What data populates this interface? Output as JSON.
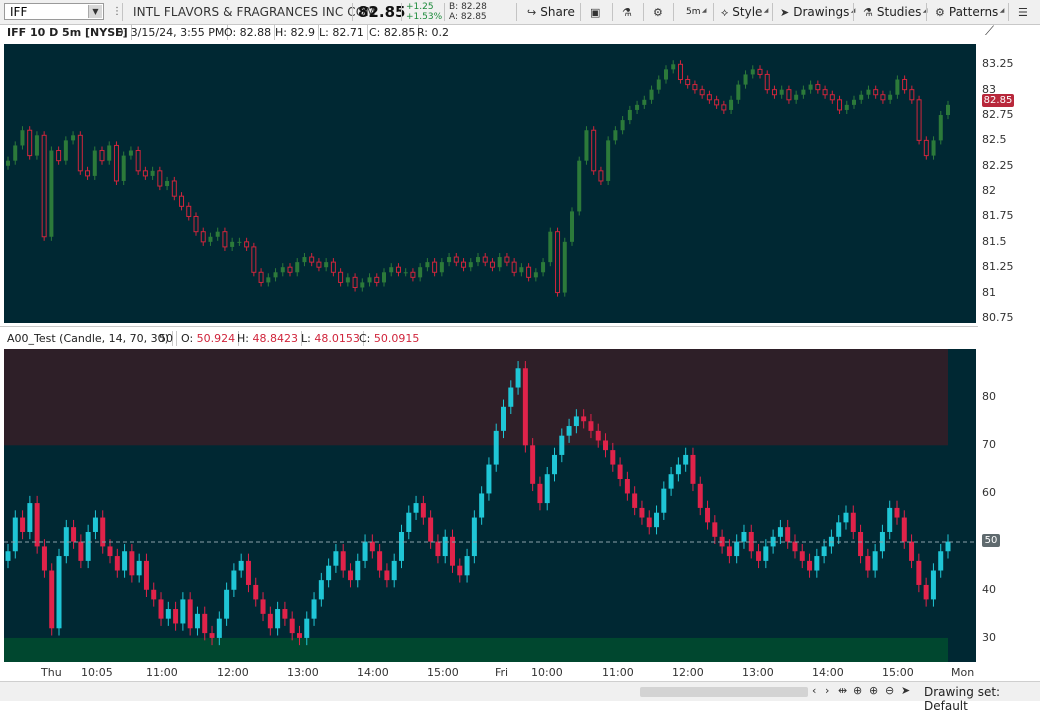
{
  "toolbar": {
    "symbol": "IFF",
    "company": "INTL FLAVORS & FRAGRANCES INC COM",
    "last": "82.85",
    "net_change": "+1.25",
    "pct_change": "+1.53%",
    "bid": "B: 82.28",
    "ask": "A: 82.85",
    "share_label": "Share",
    "timeframe_label": "5m",
    "style_label": "Style",
    "drawings_label": "Drawings",
    "studies_label": "Studies",
    "patterns_label": "Patterns"
  },
  "price_pane": {
    "title": "IFF 10 D 5m [NYSE]",
    "date": "D: 3/15/24, 3:55 PM",
    "open": "O: 82.88",
    "high": "H: 82.9",
    "low": "L: 82.71",
    "close": "C: 82.85",
    "range": "R: 0.2",
    "last_price_tag": "82.85",
    "y_ticks": [
      "83.25",
      "83",
      "82.75",
      "82.5",
      "82.25",
      "82",
      "81.75",
      "81.5",
      "81.25",
      "81",
      "80.75"
    ]
  },
  "indicator_pane": {
    "title": "A00_Test (Candle, 14, 70, 30)",
    "level": "50",
    "open": "50.924",
    "high": "48.8423",
    "low": "48.0153",
    "close": "50.0915",
    "open_label": "O:",
    "high_label": "H:",
    "low_label": "L:",
    "close_label": "C:",
    "level_tag": "50",
    "y_ticks": [
      "80",
      "70",
      "60",
      "50",
      "40",
      "30"
    ]
  },
  "x_ticks": [
    "Thu",
    "10:05",
    "11:00",
    "12:00",
    "13:00",
    "14:00",
    "15:00",
    "Fri",
    "10:00",
    "11:00",
    "12:00",
    "13:00",
    "14:00",
    "15:00",
    "Mon"
  ],
  "bottom_bar": {
    "drawing_set": "Drawing set: Default"
  },
  "colors": {
    "chart_bg": "#002833",
    "bull_candle": "#2c7a3a",
    "bear_candle": "#d0253c",
    "ind_up": "#1fc6d6",
    "ind_down": "#e0234a",
    "overbought_zone": "#2e1f28",
    "oversold_zone": "#00472f"
  },
  "chart_data": [
    {
      "type": "candlestick",
      "x_range": [
        "Thu",
        "Mon"
      ],
      "ylim": [
        80.7,
        83.45
      ],
      "y_ticks": [
        83.25,
        83,
        82.75,
        82.5,
        82.25,
        82,
        81.75,
        81.5,
        81.25,
        81,
        80.75
      ],
      "last": 82.85,
      "grid": false,
      "closes": [
        82.3,
        82.45,
        82.6,
        82.35,
        82.55,
        81.55,
        82.4,
        82.3,
        82.5,
        82.55,
        82.2,
        82.15,
        82.4,
        82.3,
        82.45,
        82.1,
        82.35,
        82.4,
        82.2,
        82.15,
        82.2,
        82.05,
        82.1,
        81.95,
        81.85,
        81.75,
        81.6,
        81.5,
        81.55,
        81.6,
        81.45,
        81.5,
        81.5,
        81.45,
        81.2,
        81.1,
        81.15,
        81.2,
        81.25,
        81.2,
        81.3,
        81.35,
        81.3,
        81.25,
        81.3,
        81.2,
        81.1,
        81.15,
        81.05,
        81.1,
        81.15,
        81.1,
        81.2,
        81.25,
        81.2,
        81.2,
        81.15,
        81.25,
        81.3,
        81.2,
        81.3,
        81.35,
        81.3,
        81.25,
        81.3,
        81.35,
        81.3,
        81.25,
        81.35,
        81.3,
        81.2,
        81.25,
        81.15,
        81.2,
        81.3,
        81.6,
        81.0,
        81.5,
        81.8,
        82.3,
        82.6,
        82.2,
        82.1,
        82.5,
        82.6,
        82.7,
        82.8,
        82.85,
        82.9,
        83.0,
        83.1,
        83.2,
        83.25,
        83.1,
        83.05,
        83.0,
        82.95,
        82.9,
        82.85,
        82.8,
        82.9,
        83.05,
        83.15,
        83.2,
        83.15,
        83.0,
        82.95,
        83.0,
        82.9,
        82.95,
        83.0,
        83.05,
        83.0,
        82.95,
        82.9,
        82.8,
        82.85,
        82.9,
        82.95,
        83.0,
        82.95,
        82.9,
        82.95,
        83.1,
        83.0,
        82.9,
        82.5,
        82.35,
        82.5,
        82.75,
        82.85
      ]
    },
    {
      "type": "candlestick",
      "title": "A00_Test (Candle, 14, 70, 30)",
      "ylim": [
        25,
        90
      ],
      "y_ticks": [
        80,
        70,
        60,
        50,
        40,
        30
      ],
      "overbought": 70,
      "oversold": 30,
      "midline": 50,
      "grid": false,
      "values": [
        48,
        55,
        52,
        58,
        49,
        44,
        32,
        47,
        53,
        50,
        46,
        52,
        55,
        49,
        47,
        44,
        48,
        43,
        46,
        40,
        38,
        34,
        36,
        33,
        38,
        32,
        35,
        31,
        30,
        34,
        40,
        44,
        46,
        41,
        38,
        35,
        32,
        36,
        34,
        31,
        30,
        34,
        38,
        42,
        45,
        48,
        44,
        42,
        46,
        50,
        48,
        44,
        42,
        46,
        52,
        56,
        58,
        55,
        50,
        47,
        51,
        45,
        43,
        47,
        55,
        60,
        66,
        73,
        78,
        82,
        86,
        70,
        62,
        58,
        64,
        68,
        72,
        74,
        76,
        75,
        73,
        71,
        69,
        66,
        63,
        60,
        57,
        55,
        53,
        56,
        61,
        64,
        66,
        68,
        62,
        57,
        54,
        51,
        49,
        47,
        50,
        52,
        48,
        46,
        49,
        51,
        53,
        50,
        48,
        46,
        44,
        47,
        49,
        51,
        54,
        56,
        52,
        47,
        44,
        48,
        52,
        57,
        55,
        50,
        46,
        41,
        38,
        44,
        48,
        50
      ]
    }
  ]
}
